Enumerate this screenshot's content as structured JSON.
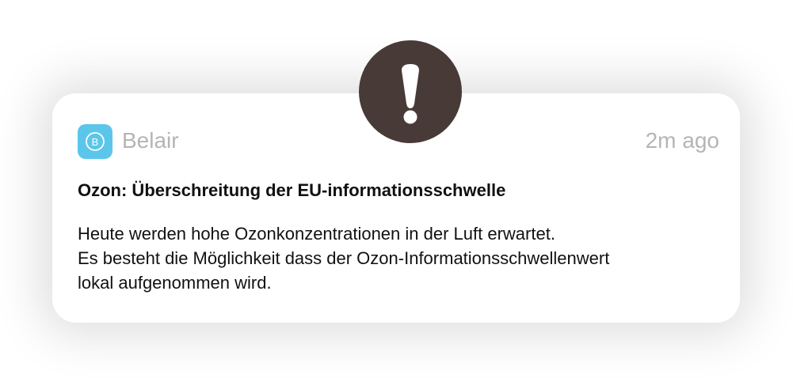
{
  "notification": {
    "app_name": "Belair",
    "app_icon": "belair-logo-icon",
    "app_icon_letter": "B",
    "timestamp": "2m ago",
    "title": "Ozon: Überschreitung der EU-informationsschwelle",
    "body_lines": [
      "Heute werden hohe Ozonkonzentrationen in der Luft erwartet.",
      "Es besteht die Möglichkeit dass der Ozon-Informationsschwellenwert",
      "lokal aufgenommen wird."
    ],
    "alert_icon": "exclamation-icon"
  },
  "colors": {
    "alert_badge": "#473a37",
    "app_icon_bg": "#5bc6ea",
    "muted_text": "#b5b5b5",
    "primary_text": "#111111"
  }
}
